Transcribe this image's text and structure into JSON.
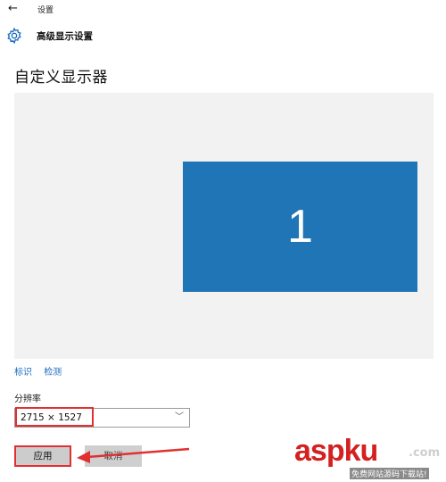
{
  "window": {
    "back_icon": "back-arrow-icon",
    "title": "设置"
  },
  "header": {
    "icon": "gear-icon",
    "title": "高级显示设置"
  },
  "section": {
    "title": "自定义显示器"
  },
  "display": {
    "monitor_number": "1",
    "monitor_color": "#1f75b5",
    "area_color": "#f2f2f2"
  },
  "links": {
    "identify": "标识",
    "detect": "检测"
  },
  "resolution": {
    "label": "分辨率",
    "value": "2715 × 1527",
    "chevron_icon": "chevron-down-icon"
  },
  "buttons": {
    "apply": "应用",
    "cancel": "取消"
  },
  "annotations": {
    "highlight_color": "#e03030"
  },
  "watermark": {
    "main": "aspku",
    "suffix": ".com",
    "sub": "免费网站源码下载站!"
  }
}
